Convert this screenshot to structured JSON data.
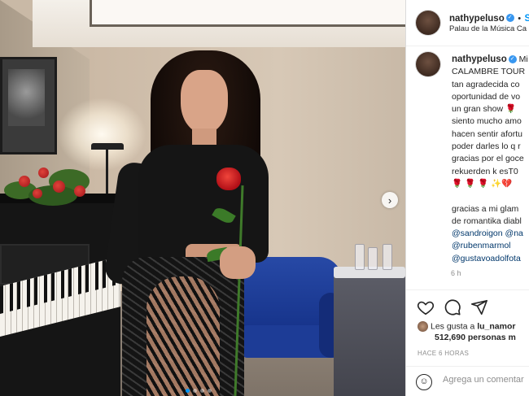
{
  "post": {
    "carousel": {
      "slides": 4,
      "active_index": 0
    },
    "icons": {
      "next": "chevron-right-icon"
    }
  },
  "header": {
    "username": "nathypeluso",
    "separator": "•",
    "follow_label": "S",
    "location": "Palau de la Música Ca"
  },
  "caption": {
    "username": "nathypeluso",
    "lines": [
      "Mi",
      "CALAMBRE TOUR",
      "tan agradecida co",
      "oportunidad de vo",
      "un gran show 🌹",
      "siento mucho amo",
      "hacen sentir afortu",
      "poder darles lo q r",
      "gracias por el goce",
      "rekuerden k esT0 ",
      "🌹 🌹 🌹 ✨💔",
      "",
      "gracias a mi glam",
      "de romantika diabl"
    ],
    "mentions": [
      "@sandroigon @na",
      "@rubenmarmol",
      "@gustavoadolfota"
    ],
    "time": "6 h"
  },
  "actions": {
    "like_icon": "heart-icon",
    "comment_icon": "comment-icon",
    "share_icon": "share-icon"
  },
  "likes": {
    "liked_by_prefix": "Les gusta a ",
    "liked_by_user": "lu_namor",
    "count_text": "512,690 personas m"
  },
  "timestamp": "HACE 6 HORAS",
  "comment": {
    "emoji_icon": "emoji-icon",
    "placeholder": "Agrega un comentar"
  },
  "colors": {
    "verified": "#3897f0",
    "mention": "#00376b",
    "carousel_active": "#0095f6"
  }
}
